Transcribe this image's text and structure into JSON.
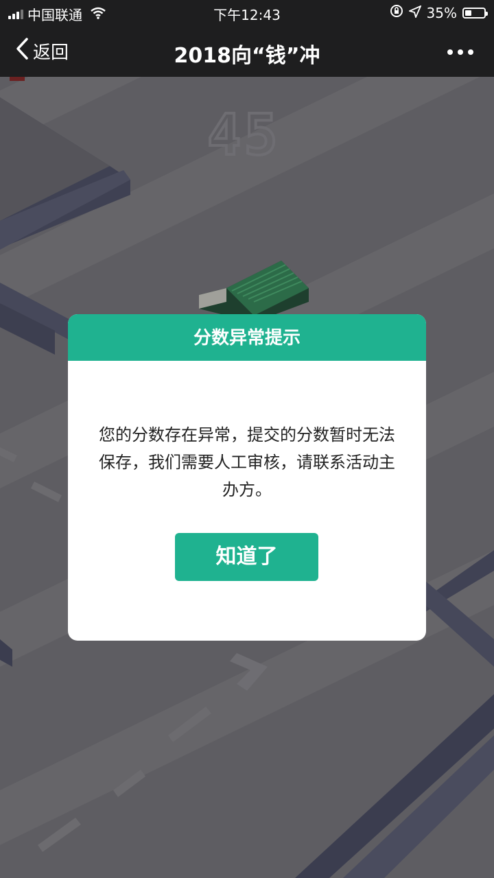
{
  "status_bar": {
    "carrier": "中国联通",
    "time": "下午12:43",
    "battery_percent_text": "35%",
    "battery_level": 0.35
  },
  "nav": {
    "back_label": "返回",
    "title": "2018向“钱”冲"
  },
  "game": {
    "score": "45"
  },
  "dialog": {
    "title": "分数异常提示",
    "message": "您的分数存在异常，提交的分数暂时无法保存，我们需要人工审核，请联系活动主办方。",
    "button_label": "知道了",
    "accent_color": "#1fb290"
  },
  "icons": [
    "signal-icon",
    "wifi-icon",
    "orientation-lock-icon",
    "location-arrow-icon",
    "battery-icon",
    "back-chevron-icon",
    "more-dots-icon"
  ]
}
